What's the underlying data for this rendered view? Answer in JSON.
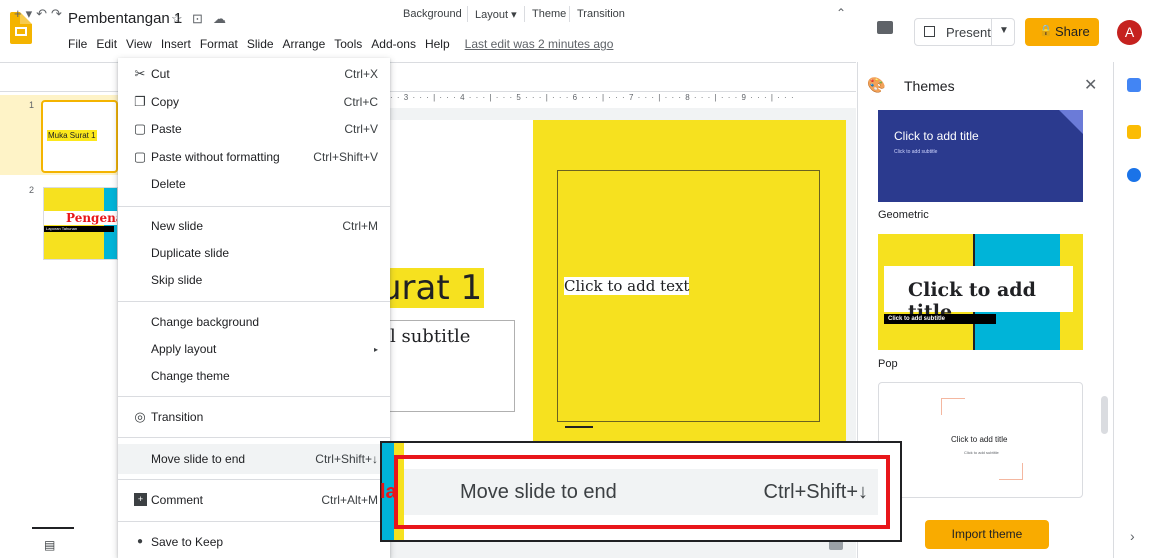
{
  "doc": {
    "title": "Pembentangan 1",
    "last_edit": "Last edit was 2 minutes ago"
  },
  "menubar": [
    "File",
    "Edit",
    "View",
    "Insert",
    "Format",
    "Slide",
    "Arrange",
    "Tools",
    "Add-ons",
    "Help"
  ],
  "header": {
    "present_label": "Present",
    "share_label": "Share",
    "avatar_initial": "A"
  },
  "toolbar": {
    "background": "Background",
    "layout": "Layout",
    "theme": "Theme",
    "transition": "Transition"
  },
  "ruler": "· · 3 · · · | · · · 4 · · · | · · · 5 · · · | · · · 6 · · · | · · · 7 · · · | · · · 8 · · · | · · · 9 · · · | · · ·",
  "filmstrip": {
    "slides": [
      {
        "num": "1",
        "label": "Muka Surat 1"
      },
      {
        "num": "2",
        "title": "Pengena",
        "subtitle": "Laporan Tahunan"
      }
    ]
  },
  "slide": {
    "title": "urat 1",
    "subtitle": "l subtitle",
    "right_text": "Click to add text"
  },
  "edit_menu": {
    "items": [
      {
        "icon": "cut-icon",
        "glyph": "✂",
        "label": "Cut",
        "shortcut": "Ctrl+X"
      },
      {
        "icon": "copy-icon",
        "glyph": "❐",
        "label": "Copy",
        "shortcut": "Ctrl+C"
      },
      {
        "icon": "paste-icon",
        "glyph": "📋",
        "label": "Paste",
        "shortcut": "Ctrl+V"
      },
      {
        "icon": "paste-plain-icon",
        "glyph": "📋",
        "label": "Paste without formatting",
        "shortcut": "Ctrl+Shift+V"
      },
      {
        "icon": "",
        "glyph": "",
        "label": "Delete",
        "shortcut": ""
      },
      {
        "icon": "",
        "glyph": "",
        "label": "New slide",
        "shortcut": "Ctrl+M"
      },
      {
        "icon": "",
        "glyph": "",
        "label": "Duplicate slide",
        "shortcut": ""
      },
      {
        "icon": "",
        "glyph": "",
        "label": "Skip slide",
        "shortcut": ""
      },
      {
        "icon": "",
        "glyph": "",
        "label": "Change background",
        "shortcut": ""
      },
      {
        "icon": "",
        "glyph": "",
        "label": "Apply layout",
        "shortcut": "▸"
      },
      {
        "icon": "",
        "glyph": "",
        "label": "Change theme",
        "shortcut": ""
      },
      {
        "icon": "transition-icon",
        "glyph": "◎",
        "label": "Transition",
        "shortcut": ""
      },
      {
        "icon": "",
        "glyph": "",
        "label": "Move slide to end",
        "shortcut": "Ctrl+Shift+↓"
      },
      {
        "icon": "comment-icon",
        "glyph": "▣",
        "label": "Comment",
        "shortcut": "Ctrl+Alt+M"
      },
      {
        "icon": "keep-icon",
        "glyph": "●",
        "label": "Save to Keep",
        "shortcut": ""
      }
    ]
  },
  "zoom": {
    "label": "Move slide to end",
    "shortcut": "Ctrl+Shift+↓",
    "clipped_text": "la"
  },
  "themes": {
    "title": "Themes",
    "items": [
      {
        "name": "",
        "title": "Click to add title",
        "subtitle": "Click to add subtitle"
      },
      {
        "name": "Geometric",
        "title": "Click to add title",
        "subtitle": "Click to add subtitle"
      },
      {
        "name": "Pop",
        "title": "Click to add title",
        "subtitle": "Click to add subtitle"
      }
    ],
    "import_label": "Import theme"
  },
  "colors": {
    "accent": "#f9ab00",
    "slide_yellow": "#f6e11f",
    "cyan": "#00b4d8",
    "highlight_red": "#e8161a",
    "theme_blue": "#2b3a8e"
  }
}
